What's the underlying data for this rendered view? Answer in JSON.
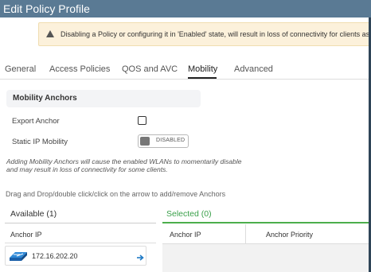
{
  "window": {
    "title": "Edit Policy Profile"
  },
  "warning": {
    "icon": "warning-triangle-icon",
    "text": "Disabling a Policy or configuring it in 'Enabled' state, will result in loss of connectivity for clients associated with this Policy profile."
  },
  "tabs": [
    {
      "label": "General",
      "active": false
    },
    {
      "label": "Access Policies",
      "active": false
    },
    {
      "label": "QOS and AVC",
      "active": false
    },
    {
      "label": "Mobility",
      "active": true
    },
    {
      "label": "Advanced",
      "active": false
    }
  ],
  "mobility": {
    "section_title": "Mobility Anchors",
    "export_anchor_label": "Export Anchor",
    "export_anchor_checked": false,
    "static_ip_label": "Static IP Mobility",
    "static_ip_state": "DISABLED",
    "note": "Adding Mobility Anchors will cause the enabled WLANs to momentarily disable and may result in loss of connectivity for some clients.",
    "drag_hint": "Drag and Drop/double click/click on the arrow to add/remove Anchors"
  },
  "available": {
    "title": "Available (1)",
    "column": "Anchor IP",
    "items": [
      {
        "ip": "172.16.202.20",
        "icon": "network-device-icon"
      }
    ]
  },
  "selected": {
    "title": "Selected (0)",
    "columns": [
      "Anchor IP",
      "Anchor Priority"
    ]
  },
  "colors": {
    "titlebar": "#5a7a94",
    "warning_bg": "#fcf1db",
    "selected_accent": "#4cae4c",
    "link_blue": "#1f7ac5"
  }
}
